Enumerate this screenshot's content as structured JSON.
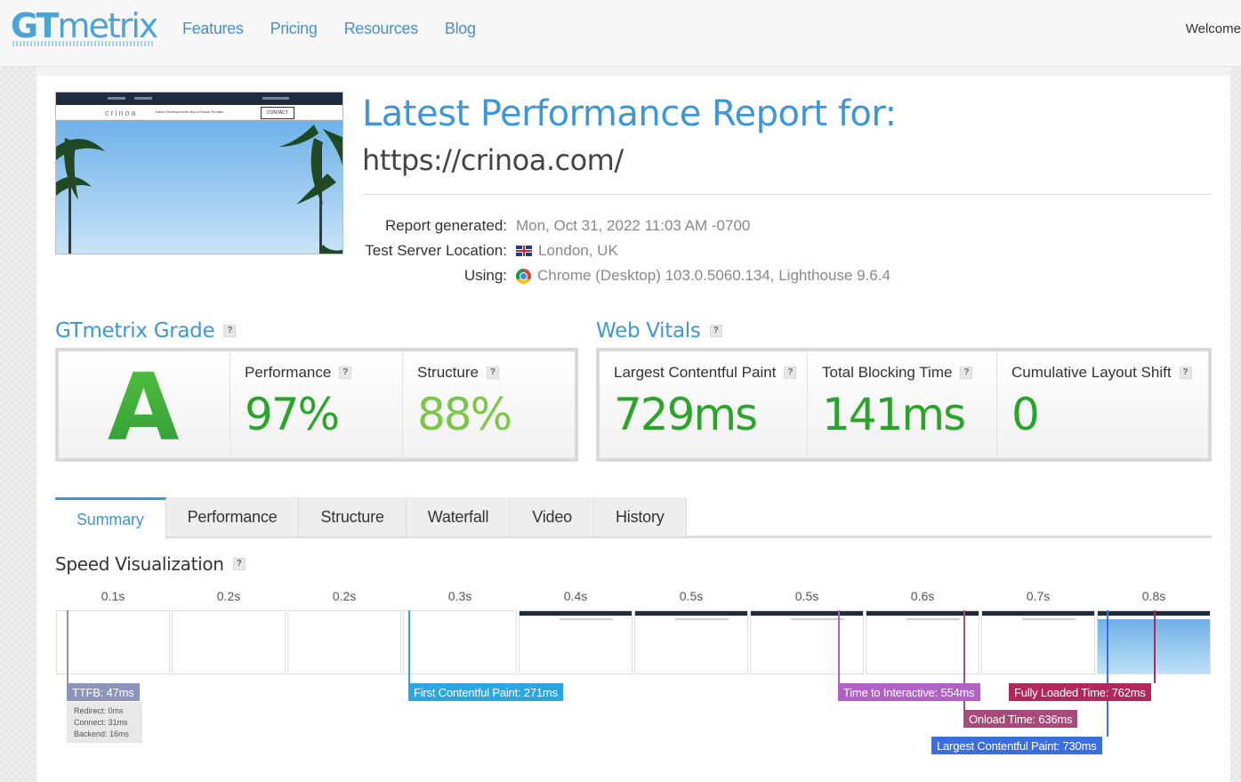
{
  "header": {
    "logo_bold": "GT",
    "logo_rest": "metrix",
    "nav": [
      "Features",
      "Pricing",
      "Resources",
      "Blog"
    ],
    "welcome": "Welcome"
  },
  "report": {
    "title": "Latest Performance Report for:",
    "url": "https://crinoa.com/",
    "generated_label": "Report generated:",
    "generated_value": "Mon, Oct 31, 2022 11:03 AM -0700",
    "location_label": "Test Server Location:",
    "location_value": "London, UK",
    "using_label": "Using:",
    "using_value": "Chrome (Desktop) 103.0.5060.134, Lighthouse 9.6.4"
  },
  "thumbnail": {
    "brand": "crinoa",
    "nav_links": "Home   Developments   Buy A House   Rentals",
    "contact": "CONTACT"
  },
  "grade": {
    "heading": "GTmetrix Grade",
    "letter": "A",
    "performance_label": "Performance",
    "performance_value": "97%",
    "structure_label": "Structure",
    "structure_value": "88%"
  },
  "vitals": {
    "heading": "Web Vitals",
    "lcp_label": "Largest Contentful Paint",
    "lcp_value": "729ms",
    "tbt_label": "Total Blocking Time",
    "tbt_value": "141ms",
    "cls_label": "Cumulative Layout Shift",
    "cls_value": "0"
  },
  "tabs": [
    "Summary",
    "Performance",
    "Structure",
    "Waterfall",
    "Video",
    "History"
  ],
  "speed": {
    "title": "Speed Visualization",
    "times": [
      "0.1s",
      "0.2s",
      "0.2s",
      "0.3s",
      "0.4s",
      "0.5s",
      "0.5s",
      "0.6s",
      "0.7s",
      "0.8s"
    ],
    "markers": {
      "ttfb": "TTFB: 47ms",
      "fcp": "First Contentful Paint: 271ms",
      "tti": "Time to Interactive: 554ms",
      "fully": "Fully Loaded Time: 762ms",
      "onload": "Onload Time: 636ms",
      "lcp": "Largest Contentful Paint: 730ms"
    },
    "ttfb_detail": {
      "redirect": "Redirect: 0ms",
      "connect": "Connect: 31ms",
      "backend": "Backend: 16ms"
    }
  },
  "colors": {
    "accent": "#3e97d5",
    "grade_green": "#3fad3f",
    "perf_green": "#2aa52a",
    "struct_green": "#7cc64a",
    "ttfb": "#8b94bd",
    "fcp": "#29a7e1",
    "tti": "#b25fc8",
    "onload": "#a94b7a",
    "fully": "#b3275a",
    "lcp": "#3b6fe0"
  }
}
